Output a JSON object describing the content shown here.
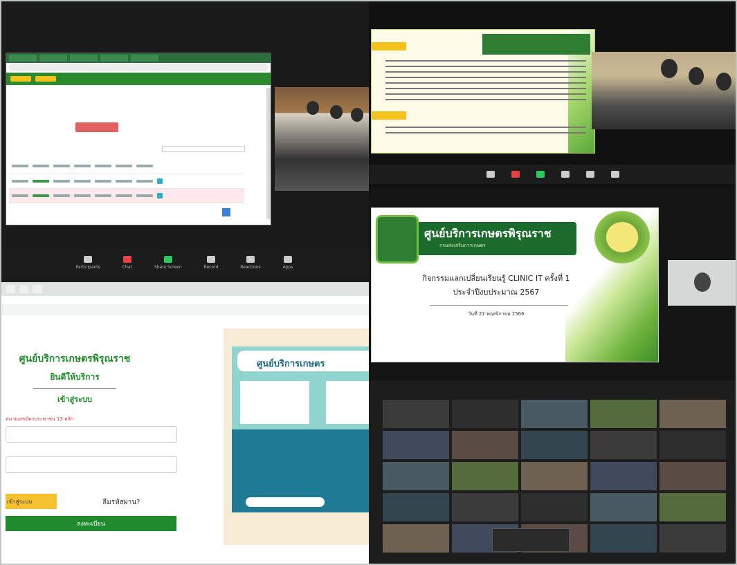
{
  "panel_login": {
    "site_title": "ศูนย์บริการเกษตรพิรุณราช",
    "welcome": "ยินดีให้บริการ",
    "login_heading": "เข้าสู่ระบบ",
    "id_label": "หมายเลขบัตรประชาชน 13 หลัก",
    "login_button": "เข้าสู่ระบบ",
    "forgot_link": "ลืมรหัสผ่าน?",
    "register_button": "ลงทะเบียน",
    "promo_title": "ศูนย์บริการเกษตร"
  },
  "panel_slide": {
    "center_name": "ศูนย์บริการเกษตรพิรุณราช",
    "department": "กรมส่งเสริมการเกษตร",
    "event_line1": "กิจกรรมแลกเปลี่ยนเรียนรู้ CLINIC IT ครั้งที่ 1",
    "event_line2": "ประจำปีงบประมาณ 2567",
    "date_line": "วันที่ 22 พฤศจิกายน 2566"
  },
  "zoom_toolbar": [
    {
      "label": "Participants",
      "icon": "participants-icon"
    },
    {
      "label": "Chat",
      "icon": "chat-icon"
    },
    {
      "label": "Share Screen",
      "icon": "share-screen-icon"
    },
    {
      "label": "Record",
      "icon": "record-icon"
    },
    {
      "label": "Reactions",
      "icon": "reactions-icon"
    },
    {
      "label": "Apps",
      "icon": "apps-icon"
    }
  ],
  "colors": {
    "accent_green": "#1f8b2c",
    "button_yellow": "#f5c12e",
    "zoom_share_green": "#2ec95c"
  }
}
